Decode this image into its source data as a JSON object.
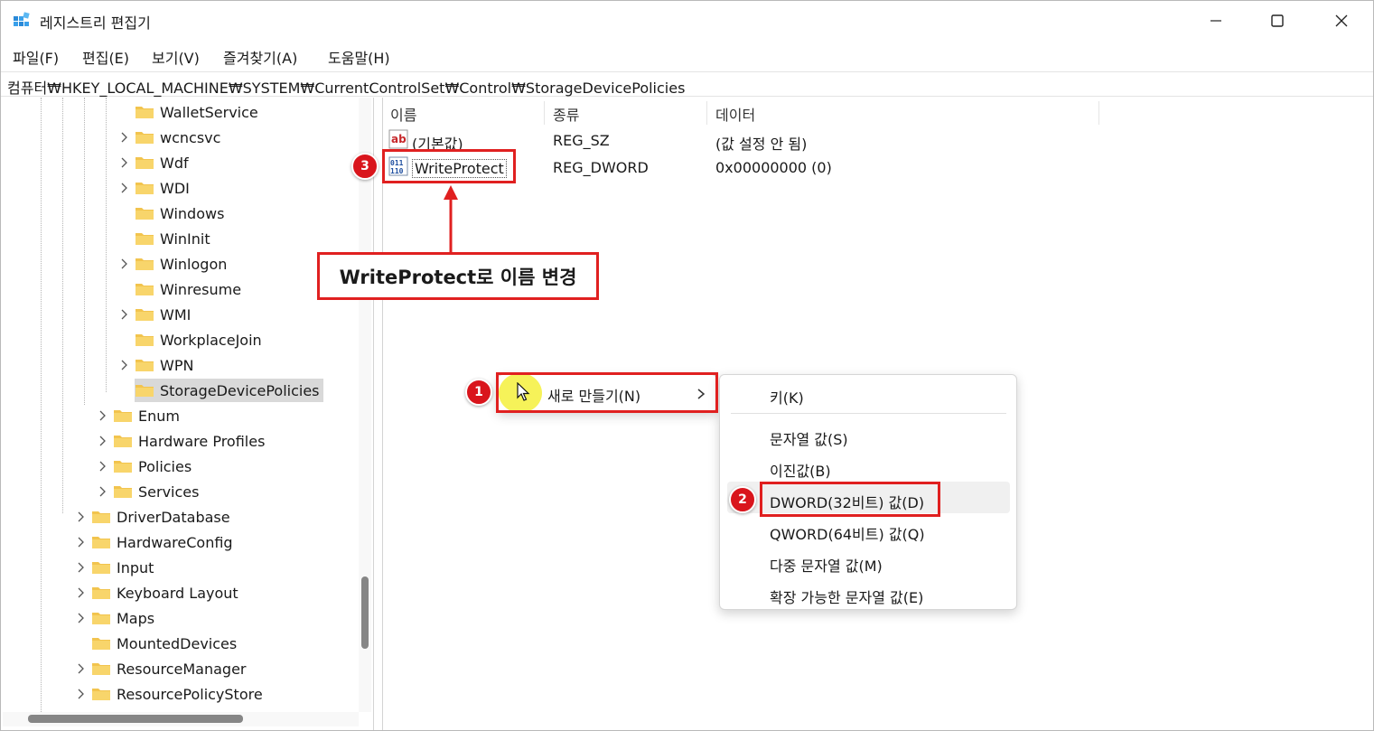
{
  "window": {
    "title": "레지스트리 편집기",
    "icon": "registry-editor-icon",
    "controls": [
      "minimize-icon",
      "maximize-icon",
      "close-icon"
    ]
  },
  "menu": [
    {
      "label": "파일(F)"
    },
    {
      "label": "편집(E)"
    },
    {
      "label": "보기(V)"
    },
    {
      "label": "즐겨찾기(A)"
    },
    {
      "label": "도움말(H)"
    }
  ],
  "address": "컴퓨터₩HKEY_LOCAL_MACHINE₩SYSTEM₩CurrentControlSet₩Control₩StorageDevicePolicies",
  "tree": {
    "items": [
      {
        "label": "WalletService",
        "expandable": false
      },
      {
        "label": "wcncsvc",
        "expandable": true
      },
      {
        "label": "Wdf",
        "expandable": true
      },
      {
        "label": "WDI",
        "expandable": true
      },
      {
        "label": "Windows",
        "expandable": false
      },
      {
        "label": "WinInit",
        "expandable": false
      },
      {
        "label": "Winlogon",
        "expandable": true
      },
      {
        "label": "Winresume",
        "expandable": false
      },
      {
        "label": "WMI",
        "expandable": true
      },
      {
        "label": "WorkplaceJoin",
        "expandable": false
      },
      {
        "label": "WPN",
        "expandable": true
      },
      {
        "label": "StorageDevicePolicies",
        "expandable": false,
        "selected": true
      },
      {
        "label": "Enum",
        "expandable": true
      },
      {
        "label": "Hardware Profiles",
        "expandable": true
      },
      {
        "label": "Policies",
        "expandable": true
      },
      {
        "label": "Services",
        "expandable": true
      },
      {
        "label": "DriverDatabase",
        "expandable": true
      },
      {
        "label": "HardwareConfig",
        "expandable": true
      },
      {
        "label": "Input",
        "expandable": true
      },
      {
        "label": "Keyboard Layout",
        "expandable": true
      },
      {
        "label": "Maps",
        "expandable": true
      },
      {
        "label": "MountedDevices",
        "expandable": false
      },
      {
        "label": "ResourceManager",
        "expandable": true
      },
      {
        "label": "ResourcePolicyStore",
        "expandable": true
      }
    ]
  },
  "list": {
    "columns": [
      "이름",
      "종류",
      "데이터"
    ],
    "rows": [
      {
        "name": "(기본값)",
        "type": "REG_SZ",
        "data": "(값 설정 안 됨)",
        "icon": "string-value-icon"
      },
      {
        "name": "WriteProtect",
        "type": "REG_DWORD",
        "data": "0x00000000 (0)",
        "icon": "binary-value-icon"
      }
    ]
  },
  "context_menu": {
    "new_label": "새로 만들기(N)",
    "submenu": {
      "items": [
        {
          "label": "키(K)"
        },
        {
          "label": "문자열 값(S)"
        },
        {
          "label": "이진값(B)"
        },
        {
          "label": "DWORD(32비트) 값(D)",
          "highlighted": true
        },
        {
          "label": "QWORD(64비트) 값(Q)"
        },
        {
          "label": "다중 문자열 값(M)"
        },
        {
          "label": "확장 가능한 문자열 값(E)"
        }
      ]
    }
  },
  "annotations": {
    "badges": [
      "1",
      "2",
      "3"
    ],
    "callout": "WriteProtect로 이름 변경",
    "accent_color": "#e02020"
  }
}
